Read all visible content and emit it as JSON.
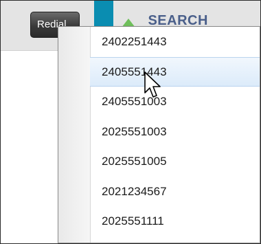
{
  "toolbar": {
    "redial_label": "Redial",
    "search_label": "SEARCH"
  },
  "colors": {
    "accent_strip": "#0a8db1",
    "search_arrow": "#6fbf5b",
    "search_text": "#4a5f8a",
    "hover_highlight": "#dcebfa"
  },
  "redial_dropdown": {
    "hovered_index": 1,
    "items": [
      "2402251443",
      "2405551443",
      "2405551003",
      "2025551003",
      "2025551005",
      "2021234567",
      "2025551111"
    ]
  },
  "icons": {
    "search": "up-triangle-icon",
    "pointer": "mouse-pointer-icon"
  }
}
